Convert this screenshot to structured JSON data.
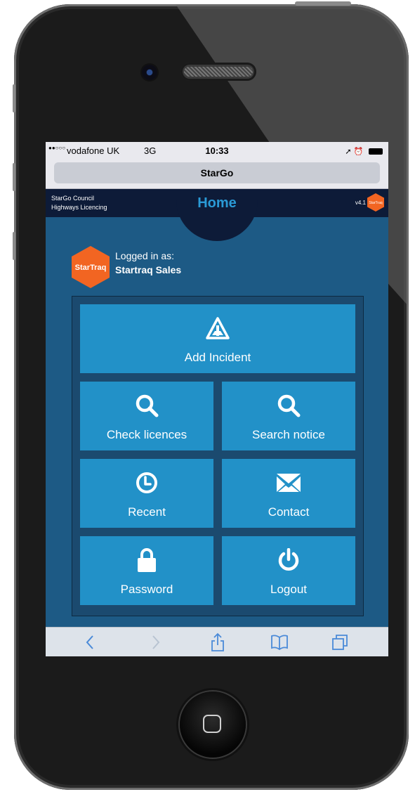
{
  "status_bar": {
    "signal": "●●○○○",
    "carrier": "vodafone UK",
    "network": "3G",
    "time": "10:33",
    "right_icons": "➚ ⏰"
  },
  "browser": {
    "url_title": "StarGo"
  },
  "app_header": {
    "council_line1": "StarGo Council",
    "council_line2": "Highways Licencing",
    "page_title": "Home",
    "version": "v4.1",
    "logo_text": "StarTraq"
  },
  "user": {
    "logo_text": "StarTraq",
    "logged_in_label": "Logged in as:",
    "username": "Startraq Sales"
  },
  "menu": {
    "add_incident": {
      "label": "Add Incident",
      "icon": "warning-triangle-icon"
    },
    "check_licences": {
      "label": "Check licences",
      "icon": "search-icon"
    },
    "search_notice": {
      "label": "Search notice",
      "icon": "search-icon"
    },
    "recent": {
      "label": "Recent",
      "icon": "clock-icon"
    },
    "contact": {
      "label": "Contact",
      "icon": "envelope-icon"
    },
    "password": {
      "label": "Password",
      "icon": "lock-icon"
    },
    "logout": {
      "label": "Logout",
      "icon": "power-icon"
    }
  },
  "toolbar": {
    "items": [
      "back-icon",
      "forward-icon",
      "share-icon",
      "bookmarks-icon",
      "tabs-icon"
    ]
  },
  "colors": {
    "screen_bg": "#1d5a85",
    "header_bg": "#0d1b38",
    "tile_bg": "#2291c8",
    "title_accent": "#2a9ad6",
    "brand_orange": "#f26522"
  }
}
